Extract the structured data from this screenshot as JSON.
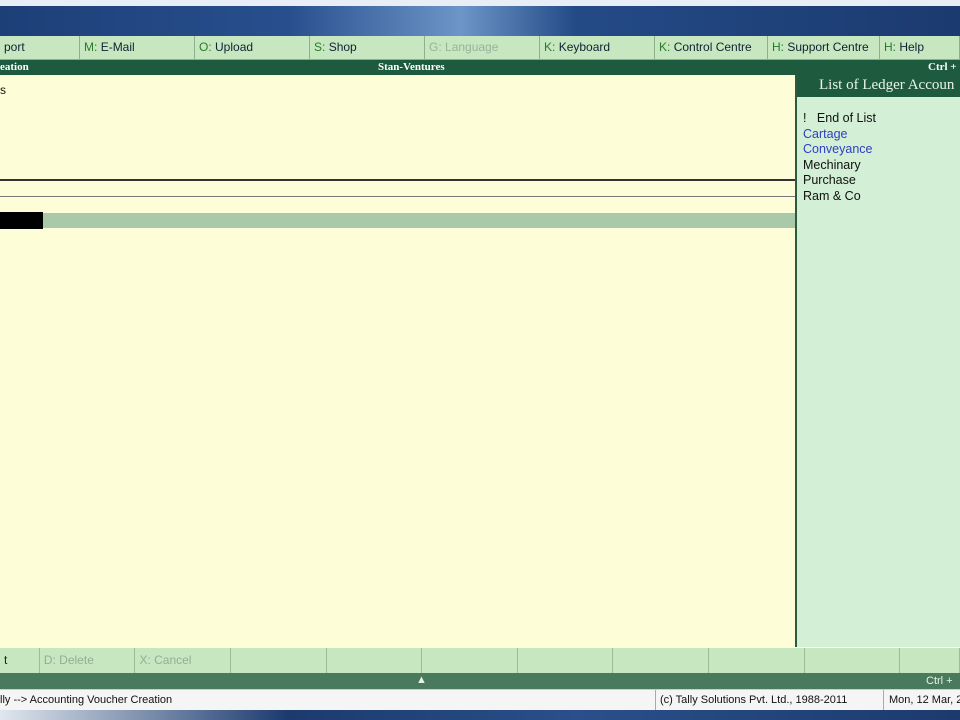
{
  "menu": [
    {
      "key": "",
      "label": "port",
      "disabled": false
    },
    {
      "key": "M:",
      "label": "E-Mail",
      "disabled": false
    },
    {
      "key": "O:",
      "label": "Upload",
      "disabled": false
    },
    {
      "key": "S:",
      "label": "Shop",
      "disabled": false
    },
    {
      "key": "G:",
      "label": "Language",
      "disabled": true
    },
    {
      "key": "K:",
      "label": "Keyboard",
      "disabled": false
    },
    {
      "key": "K:",
      "label": "Control Centre",
      "disabled": false
    },
    {
      "key": "H:",
      "label": "Support Centre",
      "disabled": false
    },
    {
      "key": "H:",
      "label": "Help",
      "disabled": false
    }
  ],
  "titlebar": {
    "left": "eation",
    "center": "Stan-Ventures",
    "right": "Ctrl +"
  },
  "main": {
    "fragment": "s"
  },
  "ledger_panel": {
    "title": "List of Ledger Accoun",
    "items": [
      "End of List",
      "Cartage",
      "Conveyance",
      "Mechinary",
      "Purchase",
      "Ram & Co"
    ],
    "end_marker": "!"
  },
  "bottom_buttons": [
    "t",
    "D: Delete",
    "X: Cancel",
    "",
    "",
    "",
    "",
    "",
    "",
    "",
    ""
  ],
  "bottom_bar": {
    "arrow": "▲",
    "right": "Ctrl +"
  },
  "status": {
    "path": "lly --> Accounting Voucher  Creation",
    "copyright": "(c) Tally Solutions Pvt. Ltd., 1988-2011",
    "date": "Mon, 12 Mar, 2"
  }
}
